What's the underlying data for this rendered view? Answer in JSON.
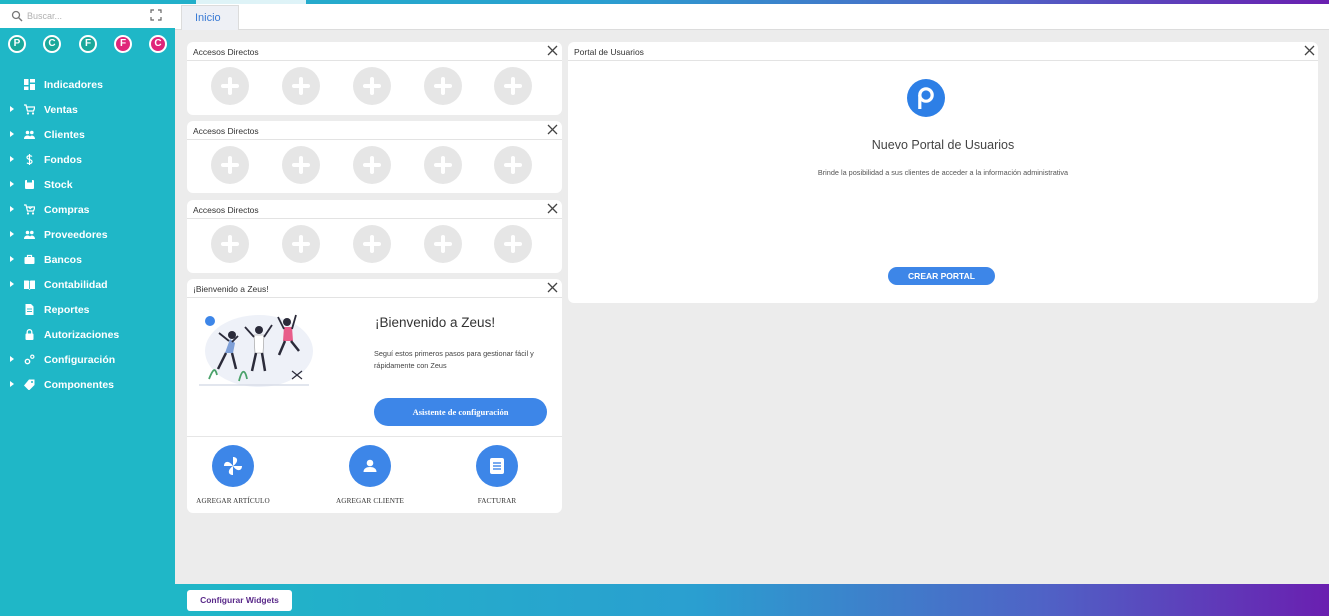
{
  "search": {
    "placeholder": "Buscar..."
  },
  "companies": [
    {
      "letter": "P",
      "color": "#1aa89a"
    },
    {
      "letter": "C",
      "color": "#1aa89a"
    },
    {
      "letter": "F",
      "color": "#1aa89a"
    },
    {
      "letter": "F",
      "color": "#e0267a"
    },
    {
      "letter": "C",
      "color": "#e0267a"
    }
  ],
  "menu": [
    {
      "label": "Indicadores",
      "icon": "dashboard-icon",
      "expandable": false
    },
    {
      "label": "Ventas",
      "icon": "cart-icon",
      "expandable": true
    },
    {
      "label": "Clientes",
      "icon": "people-icon",
      "expandable": true
    },
    {
      "label": "Fondos",
      "icon": "dollar-icon",
      "expandable": true
    },
    {
      "label": "Stock",
      "icon": "box-icon",
      "expandable": true
    },
    {
      "label": "Compras",
      "icon": "cart-check-icon",
      "expandable": true
    },
    {
      "label": "Proveedores",
      "icon": "people-icon",
      "expandable": true
    },
    {
      "label": "Bancos",
      "icon": "briefcase-icon",
      "expandable": true
    },
    {
      "label": "Contabilidad",
      "icon": "book-icon",
      "expandable": true
    },
    {
      "label": "Reportes",
      "icon": "document-icon",
      "expandable": false
    },
    {
      "label": "Autorizaciones",
      "icon": "lock-icon",
      "expandable": false
    },
    {
      "label": "Configuración",
      "icon": "gears-icon",
      "expandable": true
    },
    {
      "label": "Componentes",
      "icon": "tag-icon",
      "expandable": true
    }
  ],
  "tabs": [
    {
      "label": "Inicio",
      "active": true
    }
  ],
  "shortcuts": {
    "title": "Accesos Directos",
    "slots": 5
  },
  "welcome": {
    "header": "¡Bienvenido a Zeus!",
    "title": "¡Bienvenido a Zeus!",
    "text": "Seguí estos primeros pasos para gestionar fácil y rápidamente con Zeus",
    "button": "Asistente de configuración",
    "actions": [
      {
        "label": "AGREGAR ARTÍCULO",
        "icon": "pinwheel-icon"
      },
      {
        "label": "AGREGAR CLIENTE",
        "icon": "person-icon"
      },
      {
        "label": "FACTURAR",
        "icon": "invoice-icon"
      }
    ]
  },
  "portal": {
    "header": "Portal de Usuarios",
    "title": "Nuevo Portal de Usuarios",
    "subtitle": "Brinde la posibilidad a sus clientes de acceder a la información administrativa",
    "button": "CREAR PORTAL"
  },
  "footer": {
    "button": "Configurar Widgets"
  },
  "colors": {
    "accent": "#1fb7c7",
    "primary_button": "#3d86e8",
    "footer_end": "#6a1fb0"
  }
}
